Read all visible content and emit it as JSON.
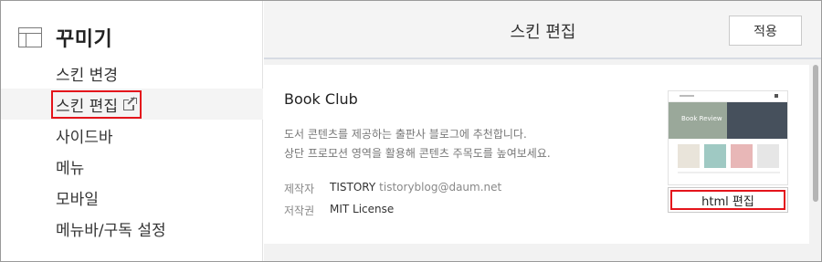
{
  "sidebar": {
    "title": "꾸미기",
    "items": [
      {
        "label": "스킨 변경"
      },
      {
        "label": "스킨 편집"
      },
      {
        "label": "사이드바"
      },
      {
        "label": "메뉴"
      },
      {
        "label": "모바일"
      },
      {
        "label": "메뉴바/구독 설정"
      }
    ]
  },
  "header": {
    "title": "스킨 편집",
    "apply_label": "적용"
  },
  "skin": {
    "name": "Book Club",
    "description_line1": "도서 콘텐츠를 제공하는 출판사 블로그에 추천합니다.",
    "description_line2": "상단 프로모션 영역을 활용해 콘텐츠 주목도를 높여보세요.",
    "author_label": "제작자",
    "author_name": "TISTORY",
    "author_email": "tistoryblog@daum.net",
    "license_label": "저작권",
    "license_value": "MIT License",
    "thumb_caption": "Book Review",
    "html_edit_label": "html 편집"
  },
  "colors": {
    "highlight": "#e4141b",
    "sidebar_active_bg": "#f4f4f4",
    "main_bg": "#f2f2f2"
  },
  "icons": {
    "sidebar_header": "layout-icon",
    "external_link": "external-link-icon"
  }
}
